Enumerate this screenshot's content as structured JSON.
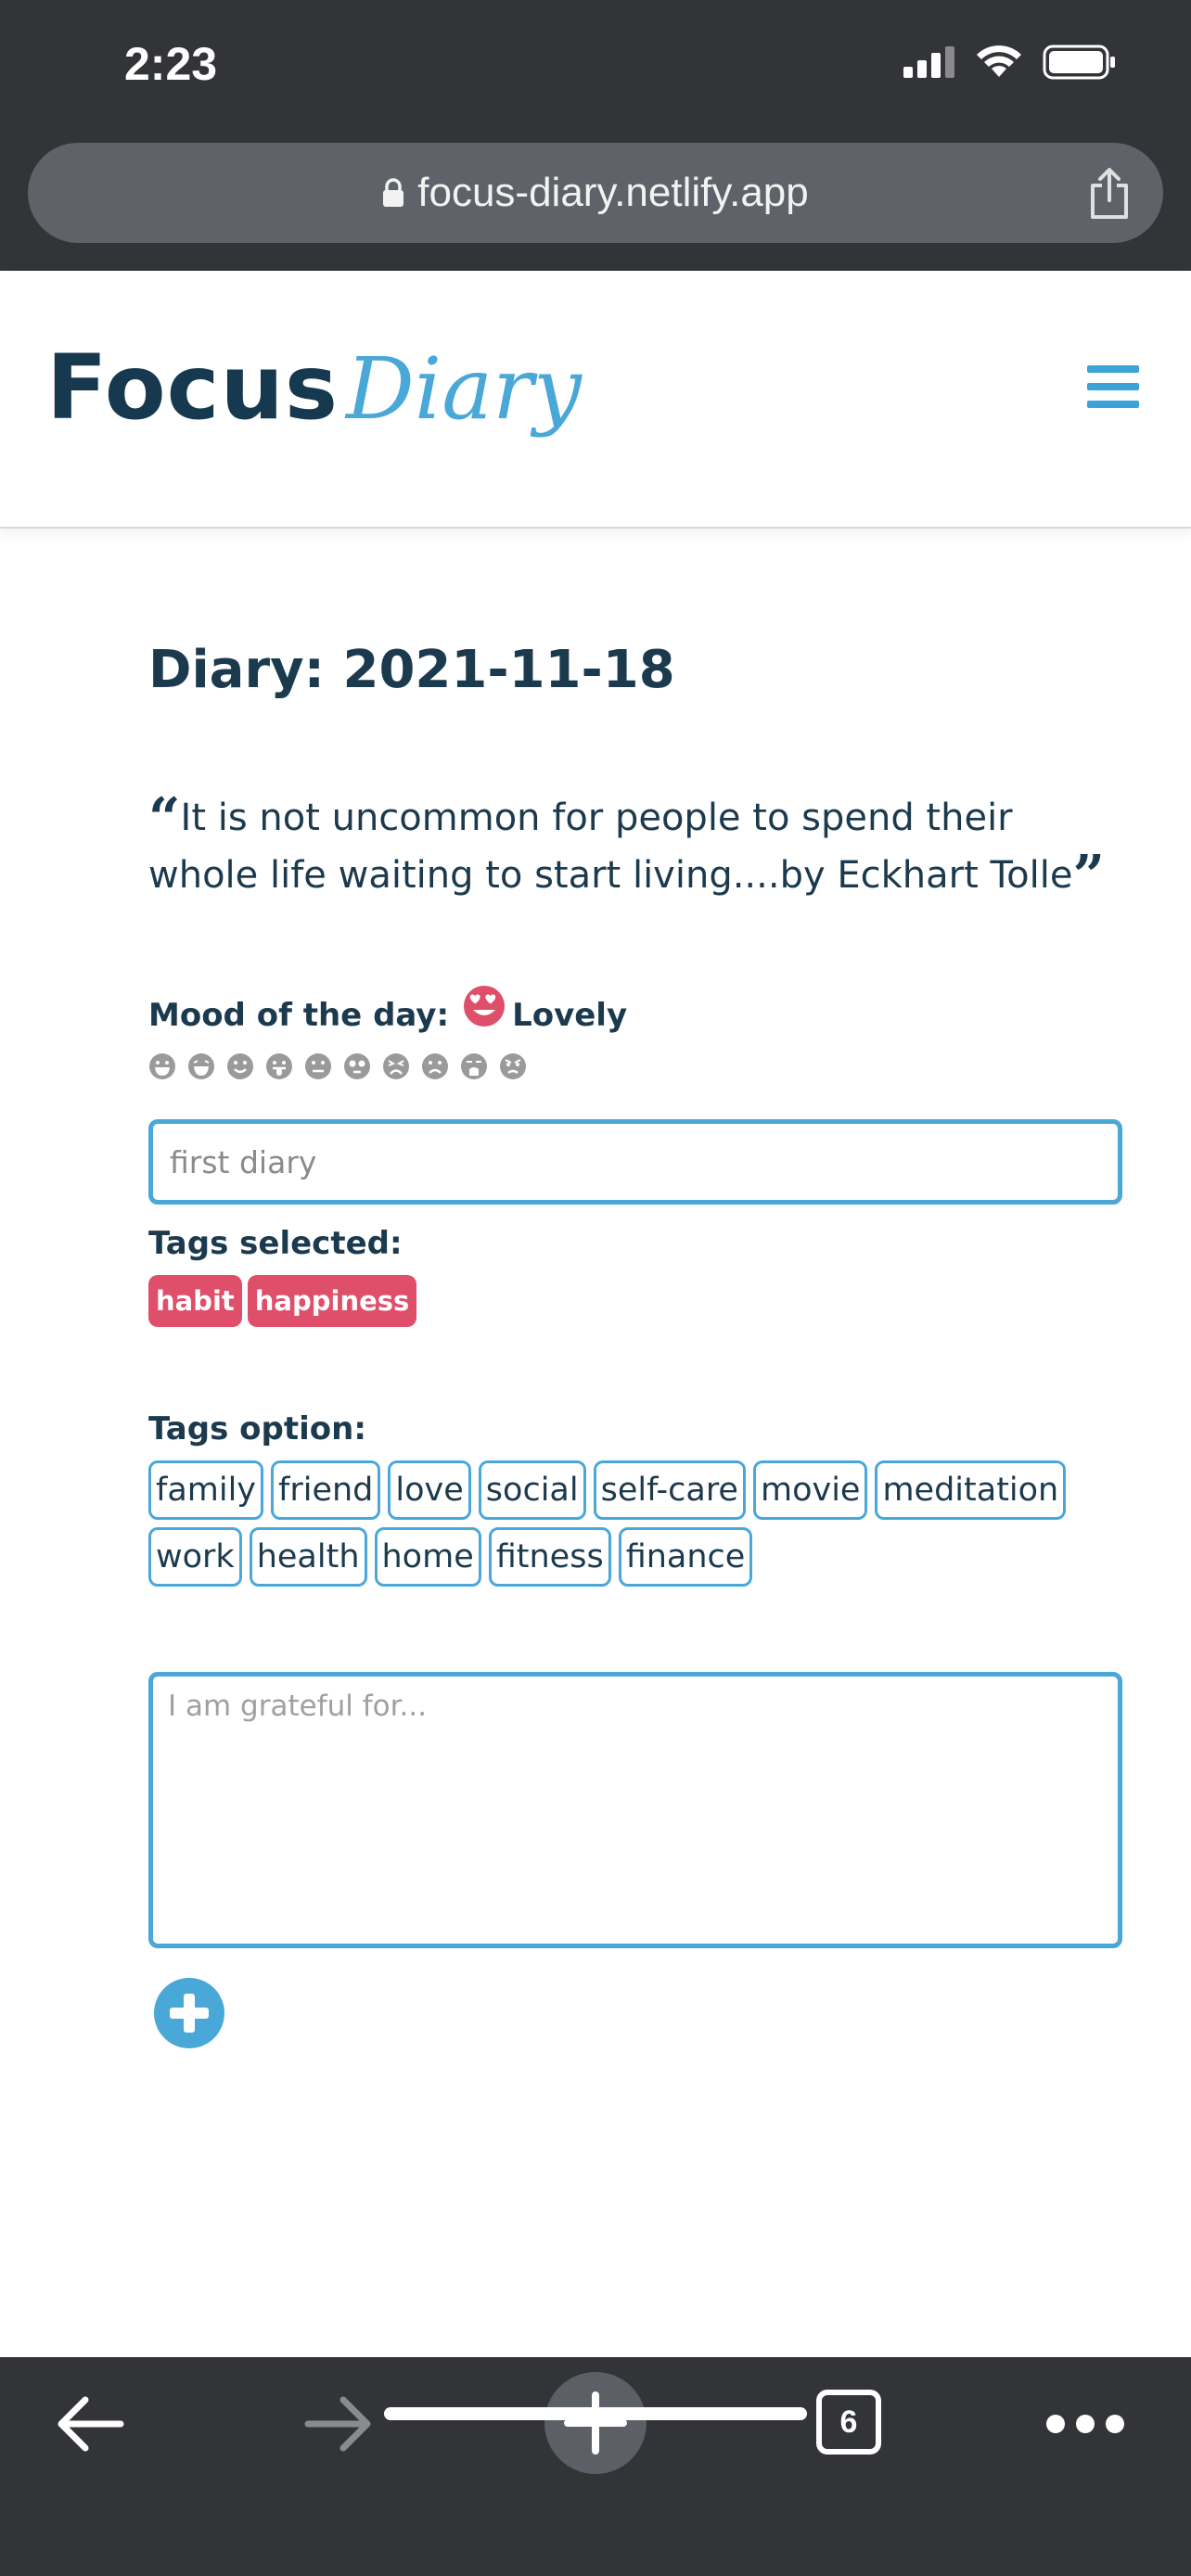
{
  "status_bar": {
    "time": "2:23"
  },
  "browser": {
    "url": "focus-diary.netlify.app",
    "tab_count": "6"
  },
  "header": {
    "logo_focus": "Focus",
    "logo_diary": "Diary"
  },
  "diary": {
    "title": "Diary: 2021-11-18",
    "quote_text": "It is not uncommon for people to spend their whole life waiting to start living....by Eckhart Tolle",
    "mood_label": "Mood of the day:",
    "mood_value": "Lovely",
    "mood_options": [
      "grin-icon",
      "laugh-icon",
      "smile-icon",
      "tongue-icon",
      "neutral-icon",
      "surprise-icon",
      "tired-icon",
      "frown-icon",
      "sad-cry-icon",
      "angry-icon"
    ],
    "title_value": "first diary",
    "tags_selected_label": "Tags selected:",
    "tags_selected": [
      "habit",
      "happiness"
    ],
    "tags_option_label": "Tags option:",
    "tags_options": [
      "family",
      "friend",
      "love",
      "social",
      "self-care",
      "movie",
      "meditation",
      "work",
      "health",
      "home",
      "fitness",
      "finance"
    ],
    "grateful_placeholder": "I am grateful for..."
  },
  "colors": {
    "accent": "#4aa8d8",
    "tag_selected": "#df4f6a",
    "text": "#1c3a4e",
    "browser_chrome": "#333437"
  }
}
